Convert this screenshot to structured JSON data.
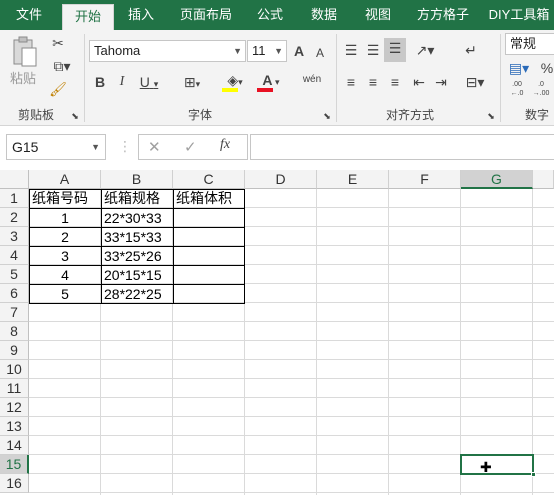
{
  "tabs": [
    "文件",
    "开始",
    "插入",
    "页面布局",
    "公式",
    "数据",
    "视图",
    "方方格子",
    "DIY工具箱"
  ],
  "clipboard": {
    "paste_label": "粘贴",
    "group_label": "剪贴板"
  },
  "font": {
    "name": "Tahoma",
    "size": "11",
    "group_label": "字体",
    "bold": "B",
    "italic": "I",
    "underline": "U",
    "grow": "A",
    "shrink": "A",
    "phonetic": "wén",
    "font_color": "A"
  },
  "align": {
    "group_label": "对齐方式"
  },
  "number": {
    "format": "常规",
    "group_label": "数字",
    "percent": "%",
    "inc_decimal": ".00 ←.0",
    "dec_decimal": ".0 →.00"
  },
  "formula_bar": {
    "name_box": "G15",
    "cancel": "✕",
    "enter": "✓",
    "fx": "fx",
    "value": ""
  },
  "columns": [
    "A",
    "B",
    "C",
    "D",
    "E",
    "F",
    "G"
  ],
  "rows": [
    "1",
    "2",
    "3",
    "4",
    "5",
    "6",
    "7",
    "8",
    "9",
    "10",
    "11",
    "12",
    "13",
    "14",
    "15",
    "16"
  ],
  "cells": {
    "header": [
      "纸箱号码",
      "纸箱规格",
      "纸箱体积"
    ],
    "data": [
      [
        "1",
        "22*30*33",
        ""
      ],
      [
        "2",
        "33*15*33",
        ""
      ],
      [
        "3",
        "33*25*26",
        ""
      ],
      [
        "4",
        "20*15*15",
        ""
      ],
      [
        "5",
        "28*22*25",
        ""
      ]
    ]
  },
  "colors": {
    "accent": "#217346",
    "ribbon": "#f3f3f3",
    "font_color_bar": "#e81123",
    "fill_color_bar": "#ffff00"
  }
}
